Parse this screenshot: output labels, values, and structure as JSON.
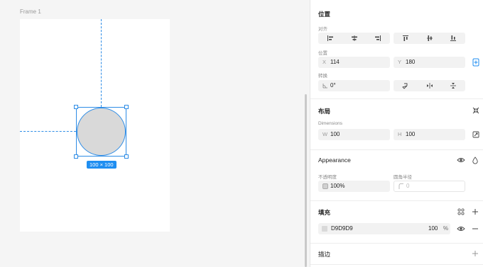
{
  "canvas": {
    "frame_label": "Frame 1",
    "selection_size": "100 × 100",
    "shape_fill": "#D9D9D9",
    "selection_color": "#2D8CE6"
  },
  "panel": {
    "position": {
      "title": "位置",
      "align_label": "对齐",
      "position_label": "位置",
      "x_prefix": "X",
      "x_value": "114",
      "y_prefix": "Y",
      "y_value": "180",
      "rotate_label": "转换",
      "rotation_value": "0°"
    },
    "layout": {
      "title": "布局",
      "dimensions_label": "Dimensions",
      "w_prefix": "W",
      "w_value": "100",
      "h_prefix": "H",
      "h_value": "100"
    },
    "appearance": {
      "title": "Appearance",
      "opacity_label": "不透明度",
      "opacity_value": "100%",
      "radius_label": "圆角半径",
      "radius_value": "0"
    },
    "fill": {
      "title": "填充",
      "color_hex": "D9D9D9",
      "opacity": "100",
      "percent": "%"
    },
    "stroke": {
      "title": "描边"
    }
  }
}
